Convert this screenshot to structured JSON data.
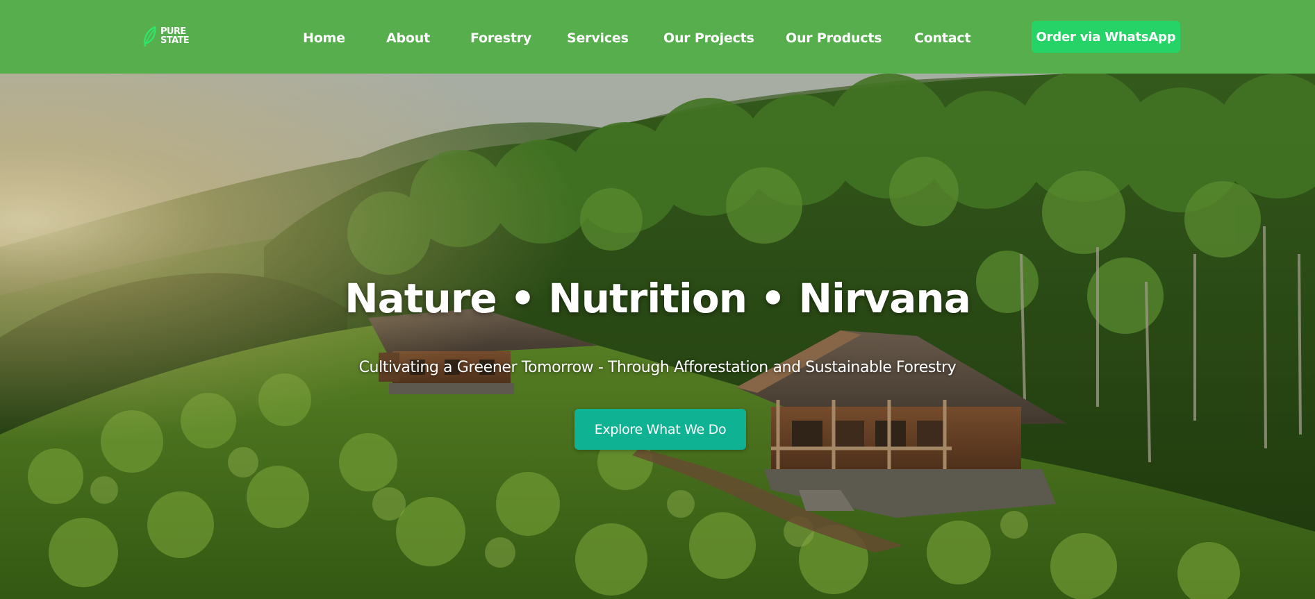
{
  "brand": {
    "logo_line1": "PURE",
    "logo_line2": "STATE",
    "logo_icon": "leaf-icon"
  },
  "nav": {
    "items": [
      {
        "label": "Home"
      },
      {
        "label": "About"
      },
      {
        "label": "Forestry"
      },
      {
        "label": "Services"
      },
      {
        "label": "Our Projects"
      },
      {
        "label": "Our Products"
      },
      {
        "label": "Contact"
      }
    ],
    "cta_label": "Order via WhatsApp"
  },
  "hero": {
    "title": "Nature • Nutrition • Nirvana",
    "subtitle": "Cultivating a Greener Tomorrow - Through Afforestation and Sustainable Forestry",
    "cta_label": "Explore What We Do"
  },
  "colors": {
    "header": "#56ae4d",
    "whatsapp": "#25d366",
    "cta": "#0fb293"
  }
}
